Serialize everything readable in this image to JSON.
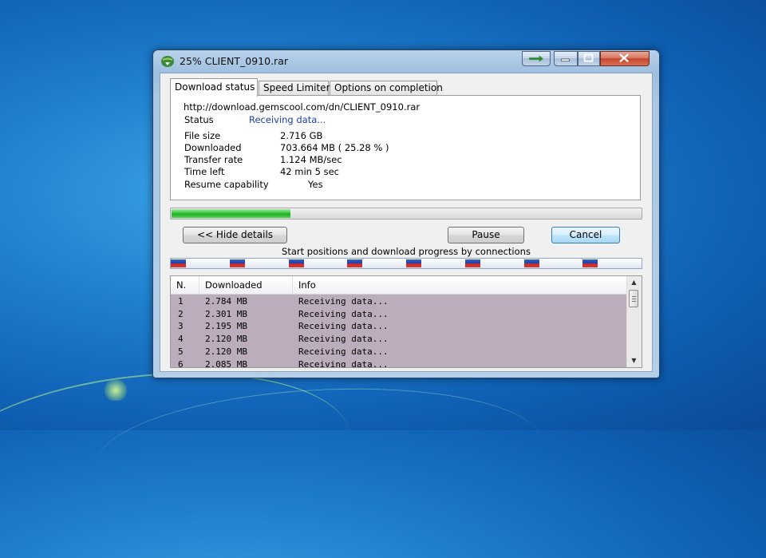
{
  "window": {
    "title": "25% CLIENT_0910.rar",
    "icons": {
      "app": "idm-globe-icon",
      "close": "close-icon",
      "minimize": "minimize-icon",
      "maximize": "maximize-icon",
      "taskbar": "send-to-taskbar-icon"
    }
  },
  "tabs": [
    {
      "label": "Download status"
    },
    {
      "label": "Speed Limiter"
    },
    {
      "label": "Options on completion"
    }
  ],
  "status": {
    "url": "http://download.gemscool.com/dn/CLIENT_0910.rar",
    "status_label": "Status",
    "status_value": "Receiving data...",
    "file_size_label": "File size",
    "file_size_value": "2.716  GB",
    "downloaded_label": "Downloaded",
    "downloaded_value": "703.664  MB  ( 25.28 % )",
    "transfer_rate_label": "Transfer rate",
    "transfer_rate_value": "1.124  MB/sec",
    "time_left_label": "Time left",
    "time_left_value": "42 min 5 sec",
    "resume_label": "Resume capability",
    "resume_value": "Yes"
  },
  "progress": {
    "fraction": 0.2528,
    "color": "#2ec42f"
  },
  "buttons": {
    "hide_details": "<< Hide details",
    "pause": "Pause",
    "cancel": "Cancel"
  },
  "connections": {
    "label": "Start positions and download progress by connections",
    "count": 8
  },
  "list": {
    "headers": {
      "n": "N.",
      "downloaded": "Downloaded",
      "info": "Info"
    },
    "rows": [
      {
        "n": "1",
        "downloaded": "2.784  MB",
        "info": "Receiving data..."
      },
      {
        "n": "2",
        "downloaded": "2.301  MB",
        "info": "Receiving data..."
      },
      {
        "n": "3",
        "downloaded": "2.195  MB",
        "info": "Receiving data..."
      },
      {
        "n": "4",
        "downloaded": "2.120  MB",
        "info": "Receiving data..."
      },
      {
        "n": "5",
        "downloaded": "2.120  MB",
        "info": "Receiving data..."
      },
      {
        "n": "6",
        "downloaded": "2.085  MB",
        "info": "Receiving data..."
      }
    ]
  }
}
